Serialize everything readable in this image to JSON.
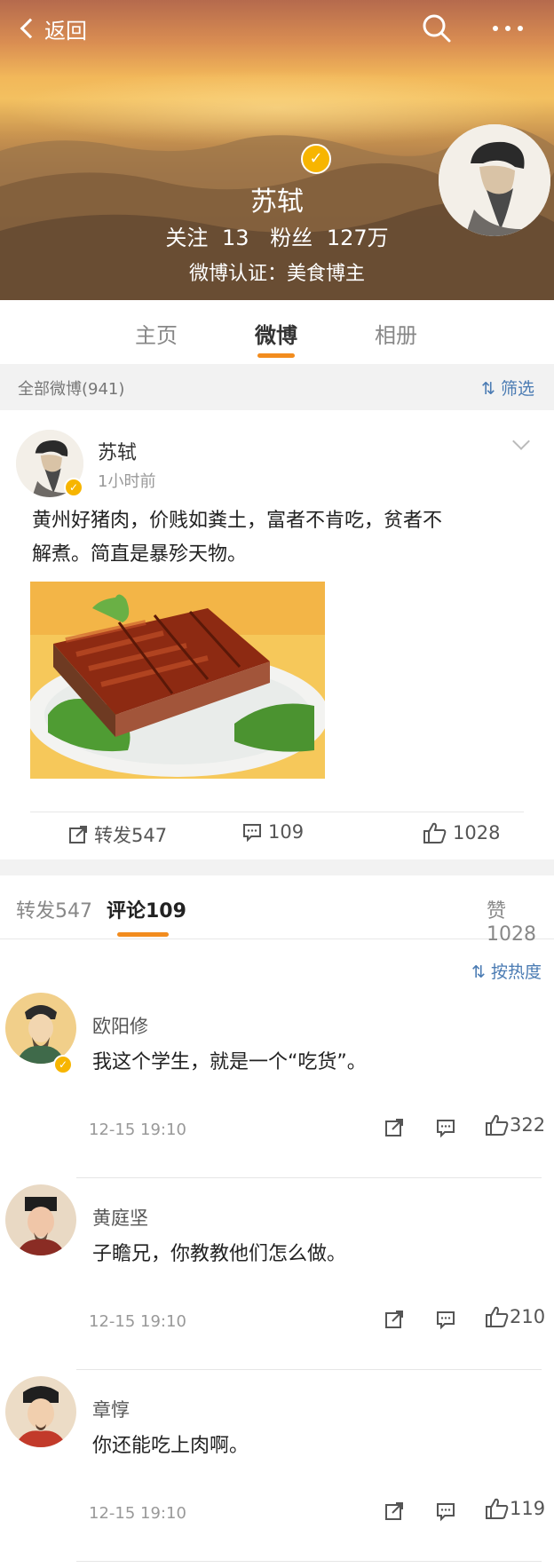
{
  "header": {
    "back_label": "返回",
    "user_name": "苏轼",
    "following_label": "关注",
    "following_count": "13",
    "followers_label": "粉丝",
    "followers_count": "127万",
    "verification": "微博认证：美食博主"
  },
  "tabs": [
    {
      "label": "主页"
    },
    {
      "label": "微博"
    },
    {
      "label": "相册"
    }
  ],
  "filter_bar": {
    "count_label": "全部微博(941)",
    "filter_label": "筛选"
  },
  "post": {
    "author": "苏轼",
    "time": "1小时前",
    "text_line1": "黄州好猪肉，价贱如粪土，富者不肯吃，贫者不",
    "text_line2": "解煮。简直是暴殄天物。",
    "repost_label": "转发547",
    "comment_label": "109",
    "like_label": "1028"
  },
  "comment_tabs": {
    "repost": "转发547",
    "comments": "评论109",
    "likes": "赞1028"
  },
  "sort_label": "按热度",
  "comments": [
    {
      "name": "欧阳修",
      "text": "我这个学生，就是一个“吃货”。",
      "date": "12-15  19:10",
      "likes": "322"
    },
    {
      "name": "黄庭坚",
      "text": "子瞻兄，你教教他们怎么做。",
      "date": "12-15  19:10",
      "likes": "210"
    },
    {
      "name": "章惇",
      "text": "你还能吃上肉啊。",
      "date": "12-15  19:10",
      "likes": "119"
    }
  ],
  "colors": {
    "accent_orange": "#f28c1e",
    "link_blue": "#4a7bb3",
    "verified_gold": "#f7b500"
  }
}
